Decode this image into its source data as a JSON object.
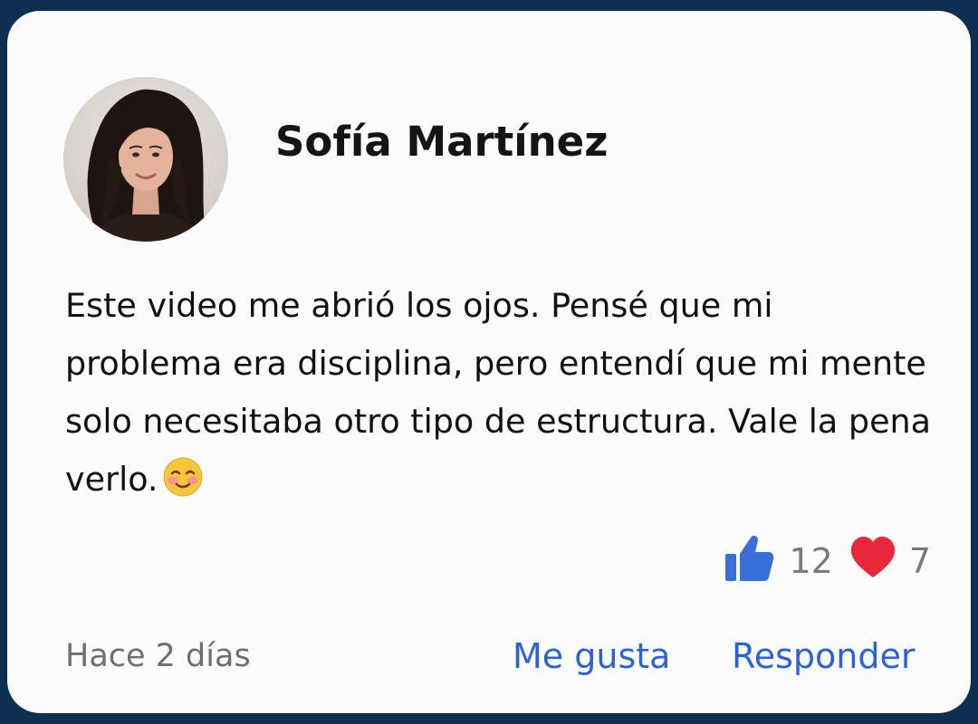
{
  "comment": {
    "author_name": "Sofía Martínez",
    "avatar_icon": "profile-photo",
    "text": "Este video me abrió los ojos. Pensé que mi problema era disciplina, pero entendí que mi mente solo necesitaba otro tipo de estructura. Vale la pena verlo.",
    "emoji": "smiling-face-with-blush-icon",
    "reactions": {
      "like_count": "12",
      "like_icon": "thumbs-up-icon",
      "like_color": "#3b6fd8",
      "love_count": "7",
      "love_icon": "heart-icon",
      "love_color": "#e8283a"
    },
    "timestamp": "Hace 2 días",
    "actions": {
      "like_label": "Me gusta",
      "reply_label": "Responder"
    }
  },
  "colors": {
    "page_background": "#0e2f52",
    "card_background": "#fbfbfc",
    "action_link": "#2b63d3",
    "muted_text": "#6f6f6f"
  }
}
